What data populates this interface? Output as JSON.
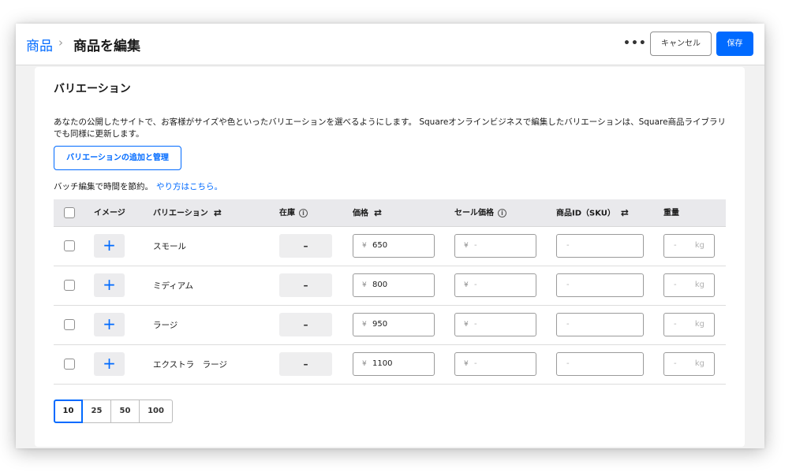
{
  "header": {
    "breadcrumb_root": "商品",
    "breadcrumb_separator": "›",
    "page_title": "商品を編集",
    "more_label": "•••",
    "cancel_label": "キャンセル",
    "save_label": "保存"
  },
  "section": {
    "title": "バリエーション",
    "description": "あなたの公開したサイトで、お客様がサイズや色といったバリエーションを選べるようにします。 Squareオンラインビジネスで編集したバリエーションは、Square商品ライブラリでも同様に更新します。",
    "manage_button": "バリエーションの追加と管理",
    "batch_note": "バッチ編集で時間を節約。",
    "batch_link": "やり方はこちら。"
  },
  "table": {
    "columns": {
      "image": "イメージ",
      "variation": "バリエーション",
      "stock": "在庫",
      "price": "価格",
      "sale_price": "セール価格",
      "sku": "商品ID（SKU）",
      "weight": "重量"
    },
    "rows": [
      {
        "name": "スモール",
        "stock": "–",
        "price": "650",
        "sale_price": "-",
        "sku": "-",
        "weight": "-",
        "weight_unit": "kg"
      },
      {
        "name": "ミディアム",
        "stock": "–",
        "price": "800",
        "sale_price": "-",
        "sku": "-",
        "weight": "-",
        "weight_unit": "kg"
      },
      {
        "name": "ラージ",
        "stock": "–",
        "price": "950",
        "sale_price": "-",
        "sku": "-",
        "weight": "-",
        "weight_unit": "kg"
      },
      {
        "name": "エクストラ　ラージ",
        "stock": "–",
        "price": "1100",
        "sale_price": "-",
        "sku": "-",
        "weight": "-",
        "weight_unit": "kg"
      }
    ],
    "currency_symbol": "¥",
    "add_image_glyph": "+"
  },
  "pagination": {
    "options": [
      "10",
      "25",
      "50",
      "100"
    ],
    "selected": "10"
  },
  "colors": {
    "accent": "#006aff",
    "header_bg": "#e9e9ec"
  }
}
